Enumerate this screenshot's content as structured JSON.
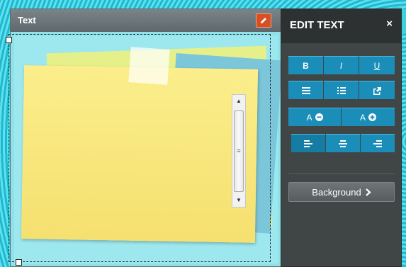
{
  "widget": {
    "title": "Text",
    "edit_icon": "pencil-icon"
  },
  "panel": {
    "title": "EDIT TEXT",
    "close_label": "×",
    "format_buttons": [
      {
        "label": "B",
        "name": "bold"
      },
      {
        "label": "I",
        "name": "italic"
      },
      {
        "label": "U",
        "name": "underline"
      }
    ],
    "list_buttons": [
      {
        "icon": "bullet-list-icon"
      },
      {
        "icon": "numbered-list-icon"
      },
      {
        "icon": "link-icon"
      }
    ],
    "size_buttons": [
      {
        "label": "A",
        "icon": "decrease-icon"
      },
      {
        "label": "A",
        "icon": "increase-icon"
      }
    ],
    "align_buttons": [
      {
        "icon": "align-left-icon"
      },
      {
        "icon": "align-center-icon"
      },
      {
        "icon": "align-right-icon"
      }
    ],
    "background_label": "Background",
    "background_icon": "chevron-right-icon"
  },
  "colors": {
    "accent": "#1a8db8",
    "panel_bg": "#404546",
    "edit_button": "#d94f22"
  }
}
